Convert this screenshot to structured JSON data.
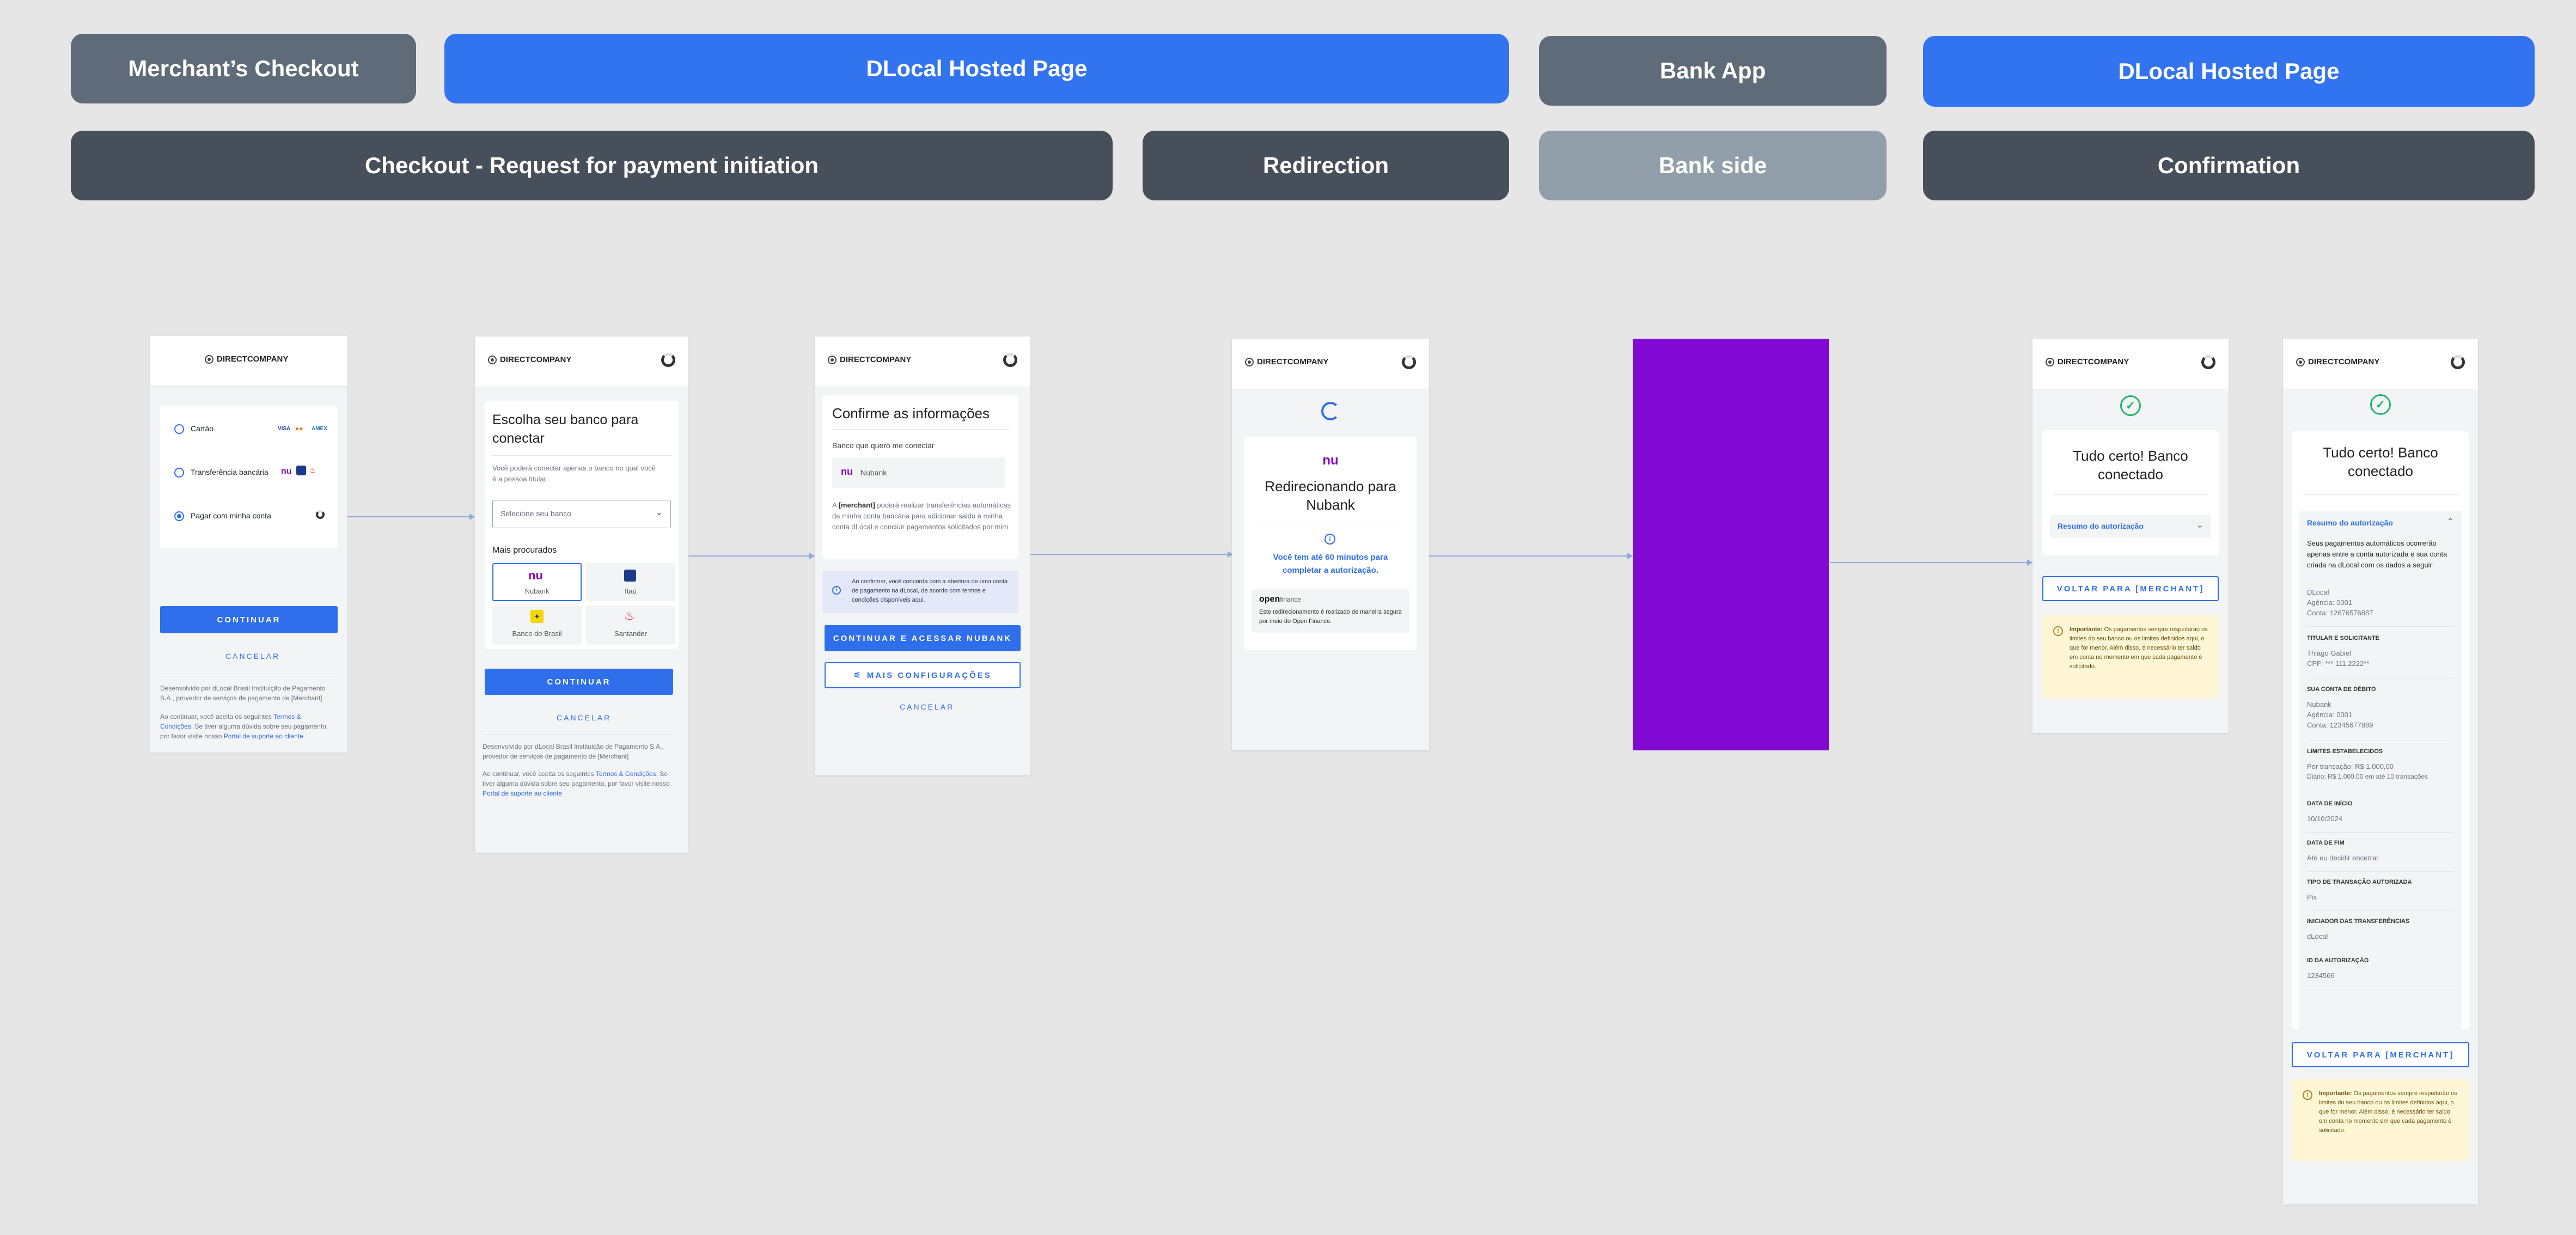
{
  "headers_top": {
    "merchant": "Merchant’s Checkout",
    "dlocal1": "DLocal Hosted Page",
    "bank_app": "Bank App",
    "dlocal2": "DLocal Hosted Page"
  },
  "headers_bottom": {
    "checkout": "Checkout - Request for payment initiation",
    "redirection": "Redirection",
    "bank_side": "Bank side",
    "confirmation": "Confirmation"
  },
  "brand": "DIRECTCOMPANY",
  "s1": {
    "opt1": "Cartão",
    "opt2": "Transferência bancária",
    "opt3": "Pagar com minha conta",
    "continuar": "CONTINUAR",
    "cancelar": "CANCELAR",
    "foot1": "Desenvolvido por dLocal Brasil Instituição de Pagamento S.A., provedor de serviços de pagamento de [Merchant]",
    "foot2a": "Ao continuar, você aceita os seguintes ",
    "foot2link": "Termos & Condições",
    "foot2b": ". Se tiver alguma dúvida sobre seu pagamento, por favor visite nosso ",
    "foot2link2": "Portal de suporte ao cliente",
    "cards": [
      "VISA",
      "●●",
      "AMEX"
    ]
  },
  "s2": {
    "title": "Escolha seu banco para conectar",
    "desc": "Você poderá conectar apenas o banco no qual você é a pessoa titular.",
    "select": "Selecione seu banco",
    "mais": "Mais procurados",
    "banks": [
      "Nubank",
      "Itaú",
      "Banco do Brasil",
      "Santander"
    ],
    "continuar": "CONTINUAR",
    "cancelar": "CANCELAR",
    "foot1": "Desenvolvido por dLocal Brasil Instituição de Pagamento S.A., provedor de serviços de pagamento de [Merchant]",
    "foot2a": "Ao continuar, você aceita os seguintes ",
    "foot2link": "Termos & Condições",
    "foot2b": ". Se tiver alguma dúvida sobre seu pagamento, por favor visite nosso ",
    "foot2link2": "Portal de suporte ao cliente"
  },
  "s3": {
    "title": "Confirme as informações",
    "bank_label": "Banco que quero me conectar",
    "bank": "Nubank",
    "desc_a": "A ",
    "desc_b": "[merchant]",
    "desc_c": " poderá realizar transferências automáticas da minha conta bancária para adicionar saldo à minha conta dLocal e concluir pagamentos solicitados por mim",
    "info": "Ao confirmar, você concorda com a abertura de uma conta de pagamento na dLocal, de acordo com termos e condições disponíveis aqui.",
    "btn1": "CONTINUAR E ACESSAR NUBANK",
    "btn2": "MAIS CONFIGURAÇÕES",
    "cancelar": "CANCELAR"
  },
  "s4": {
    "title": "Redirecionando para Nubank",
    "timer": "Você tem até 60 minutos para completar a autorização.",
    "of_a": "open",
    "of_b": "finance",
    "note": "Este redirecionamento é realizado de maneira segura por meio do Open Finance."
  },
  "s5": {
    "color": "#8208d4"
  },
  "s6": {
    "title": "Tudo certo! Banco conectado",
    "resumo": "Resumo do autorização",
    "btn": "VOLTAR PARA [MERCHANT]",
    "warn_b": "Importante:",
    "warn": " Os pagamentos sempre respeitarão os limites do seu banco ou os limites definidos aqui, o que for menor. Além disso, é necessário ter saldo em conta no momento em que cada pagamento é solicitado."
  },
  "s7": {
    "title": "Tudo certo! Banco conectado",
    "resumo": "Resumo do autorização",
    "intro": "Seus pagamentos automáticos ocorrerão apenas entre a conta autorizada e sua conta criada na dLocal com os dados a seguir:",
    "dest": [
      "DLocal",
      "Agência: 0001",
      "Conta: 12676576887"
    ],
    "sections": [
      {
        "label": "TITULAR E SOLICITANTE",
        "vals": [
          "Thiago Gabiel",
          "CPF: *** 111.2222**"
        ]
      },
      {
        "label": "SUA CONTA DE DÉBITO",
        "vals": [
          "Nubank",
          "Agência: 0001",
          "Conta: 12345677889"
        ]
      },
      {
        "label": "LIMITES ESTABELECIDOS",
        "vals": [
          "Por transação: R$ 1.000,00",
          "Diário: R$ 1.000,00 em até 10 transações"
        ]
      },
      {
        "label": "DATA DE INÍCIO",
        "vals": [
          "10/10/2024"
        ]
      },
      {
        "label": "DATA DE FIM",
        "vals": [
          "Até eu decidir encerrar"
        ]
      },
      {
        "label": "TIPO DE TRANSAÇÃO AUTORIZADA",
        "vals": [
          "Pix"
        ]
      },
      {
        "label": "INICIADOR DAS TRANSFERÊNCIAS",
        "vals": [
          "dLocal"
        ]
      },
      {
        "label": "ID DA AUTORIZAÇÃO",
        "vals": [
          "1234566"
        ]
      }
    ],
    "btn": "VOLTAR PARA [MERCHANT]",
    "warn_b": "Importante:",
    "warn": " Os pagamentos sempre respeitarão os limites do seu banco ou os limites definidos aqui, o que for menor. Além disso, é necessário ter saldo em conta no momento em que cada pagamento é solicitado."
  }
}
